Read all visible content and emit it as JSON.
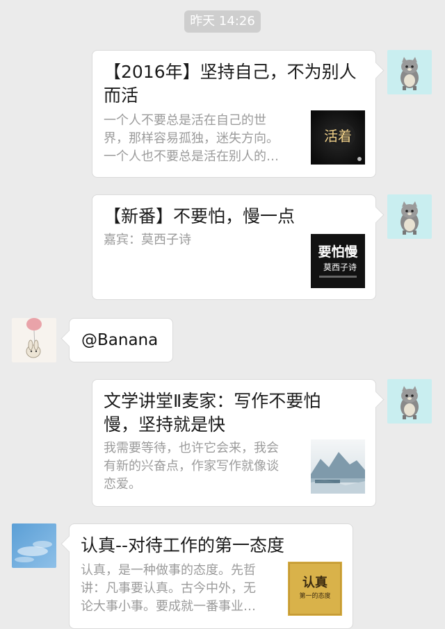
{
  "timestamp": "昨天 14:26",
  "messages": [
    {
      "title_line1": "【2016年】坚持自己，不为别人",
      "title_line2": "而活",
      "desc_line1": "一个人不要总是活在自己的世",
      "desc_line2": "界，那样容易孤独，迷失方向。",
      "desc_line3": "一个人也不要总是活在别人的…",
      "thumb_text": "活着"
    },
    {
      "title_line1": "【新番】不要怕，慢一点",
      "desc_line1": "嘉宾：莫西子诗",
      "thumb_text_line1": "要怕慢",
      "thumb_text_line2": "莫西子诗"
    },
    {
      "text": "@Banana"
    },
    {
      "title_line1": "文学讲堂Ⅱ麦家：写作不要怕",
      "title_line2": "慢，坚持就是快",
      "desc_line1": "我需要等待，也许它会来，我会",
      "desc_line2": "有新的兴奋点，作家写作就像谈",
      "desc_line3": "恋爱。"
    },
    {
      "title_line1": "认真--对待工作的第一态度",
      "desc_line1": "认真，是一种做事的态度。先哲",
      "desc_line2": "讲：凡事要认真。古今中外，无",
      "desc_line3": "论大事小事。要成就一番事业…",
      "thumb_text_line1": "认真",
      "thumb_text_line2": "第一的态度"
    }
  ],
  "avatars": {
    "self": "cat-avatar",
    "banana": "balloon-bunny-avatar",
    "sky": "sky-avatar"
  }
}
